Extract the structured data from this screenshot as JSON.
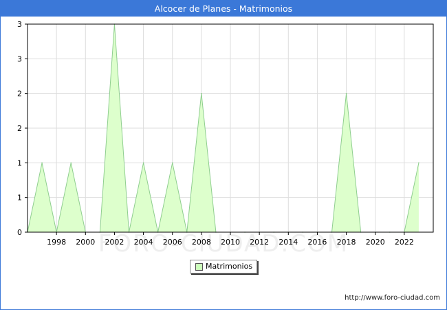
{
  "window": {
    "title": "Alcocer de Planes - Matrimonios"
  },
  "footer": {
    "source": "http://www.foro-ciudad.com"
  },
  "watermark": "FORO-CIUDAD.COM",
  "colors": {
    "title_bar": "#3b78d8",
    "area_fill": "#ddffcc",
    "area_line": "#8fce8f",
    "grid": "#dddddd"
  },
  "chart_data": {
    "type": "area",
    "title": "Alcocer de Planes - Matrimonios",
    "x": [
      1996,
      1997,
      1998,
      1999,
      2000,
      2001,
      2002,
      2003,
      2004,
      2005,
      2006,
      2007,
      2008,
      2009,
      2010,
      2011,
      2012,
      2013,
      2014,
      2015,
      2016,
      2017,
      2018,
      2019,
      2020,
      2021,
      2022,
      2023
    ],
    "series": [
      {
        "name": "Matrimonios",
        "values": [
          0,
          1,
          0,
          1,
          0,
          0,
          3,
          0,
          1,
          0,
          1,
          0,
          2,
          0,
          0,
          0,
          0,
          0,
          0,
          0,
          0,
          0,
          2,
          0,
          0,
          0,
          0,
          1
        ]
      }
    ],
    "x_ticks": [
      1998,
      2000,
      2002,
      2004,
      2006,
      2008,
      2010,
      2012,
      2014,
      2016,
      2018,
      2020,
      2022
    ],
    "y_ticks": [
      0,
      0.5,
      1,
      1.5,
      2,
      2.5,
      3
    ],
    "y_tick_labels": [
      "0",
      "1",
      "1",
      "2",
      "2",
      "3",
      "3"
    ],
    "xlim": [
      1996,
      2024
    ],
    "ylim": [
      0,
      3
    ],
    "grid": true,
    "legend": "bottom-center"
  }
}
